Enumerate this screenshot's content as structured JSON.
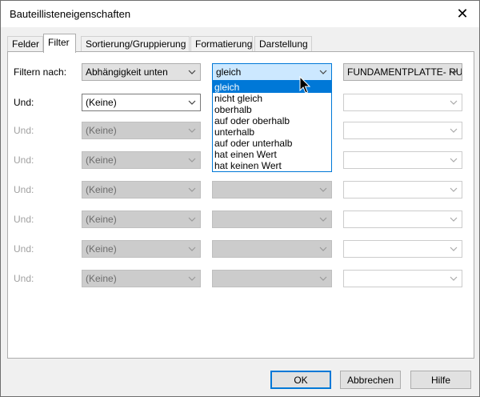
{
  "window": {
    "title": "Bauteillisteneigenschaften",
    "close_glyph": "✕"
  },
  "tabs": [
    {
      "label": "Felder",
      "active": false
    },
    {
      "label": "Filter",
      "active": true
    },
    {
      "label": "Sortierung/Gruppierung",
      "active": false
    },
    {
      "label": "Formatierung",
      "active": false
    },
    {
      "label": "Darstellung",
      "active": false
    }
  ],
  "filters": [
    {
      "label": "Filtern nach:",
      "field": "Abhängigkeit unten",
      "operator": "gleich",
      "value": "FUNDAMENTPLATTE- RU",
      "enabled": true
    },
    {
      "label": "Und:",
      "field": "(Keine)",
      "operator": "",
      "value": "",
      "enabled": true
    },
    {
      "label": "Und:",
      "field": "(Keine)",
      "operator": "",
      "value": "",
      "enabled": false
    },
    {
      "label": "Und:",
      "field": "(Keine)",
      "operator": "",
      "value": "",
      "enabled": false
    },
    {
      "label": "Und:",
      "field": "(Keine)",
      "operator": "",
      "value": "",
      "enabled": false
    },
    {
      "label": "Und:",
      "field": "(Keine)",
      "operator": "",
      "value": "",
      "enabled": false
    },
    {
      "label": "Und:",
      "field": "(Keine)",
      "operator": "",
      "value": "",
      "enabled": false
    },
    {
      "label": "Und:",
      "field": "(Keine)",
      "operator": "",
      "value": "",
      "enabled": false
    }
  ],
  "operator_dropdown": {
    "open": true,
    "selected": "gleich",
    "options": [
      "gleich",
      "nicht gleich",
      "oberhalb",
      "auf oder oberhalb",
      "unterhalb",
      "auf oder unterhalb",
      "hat einen Wert",
      "hat keinen Wert"
    ]
  },
  "buttons": {
    "ok": "OK",
    "cancel": "Abbrechen",
    "help": "Hilfe"
  },
  "colors": {
    "accent": "#0078d7",
    "selection_bg": "#cce8ff",
    "disabled_text": "#a0a0a0"
  },
  "icons": {
    "close": "close-icon",
    "chevron": "chevron-down-icon",
    "cursor": "mouse-pointer-icon"
  }
}
